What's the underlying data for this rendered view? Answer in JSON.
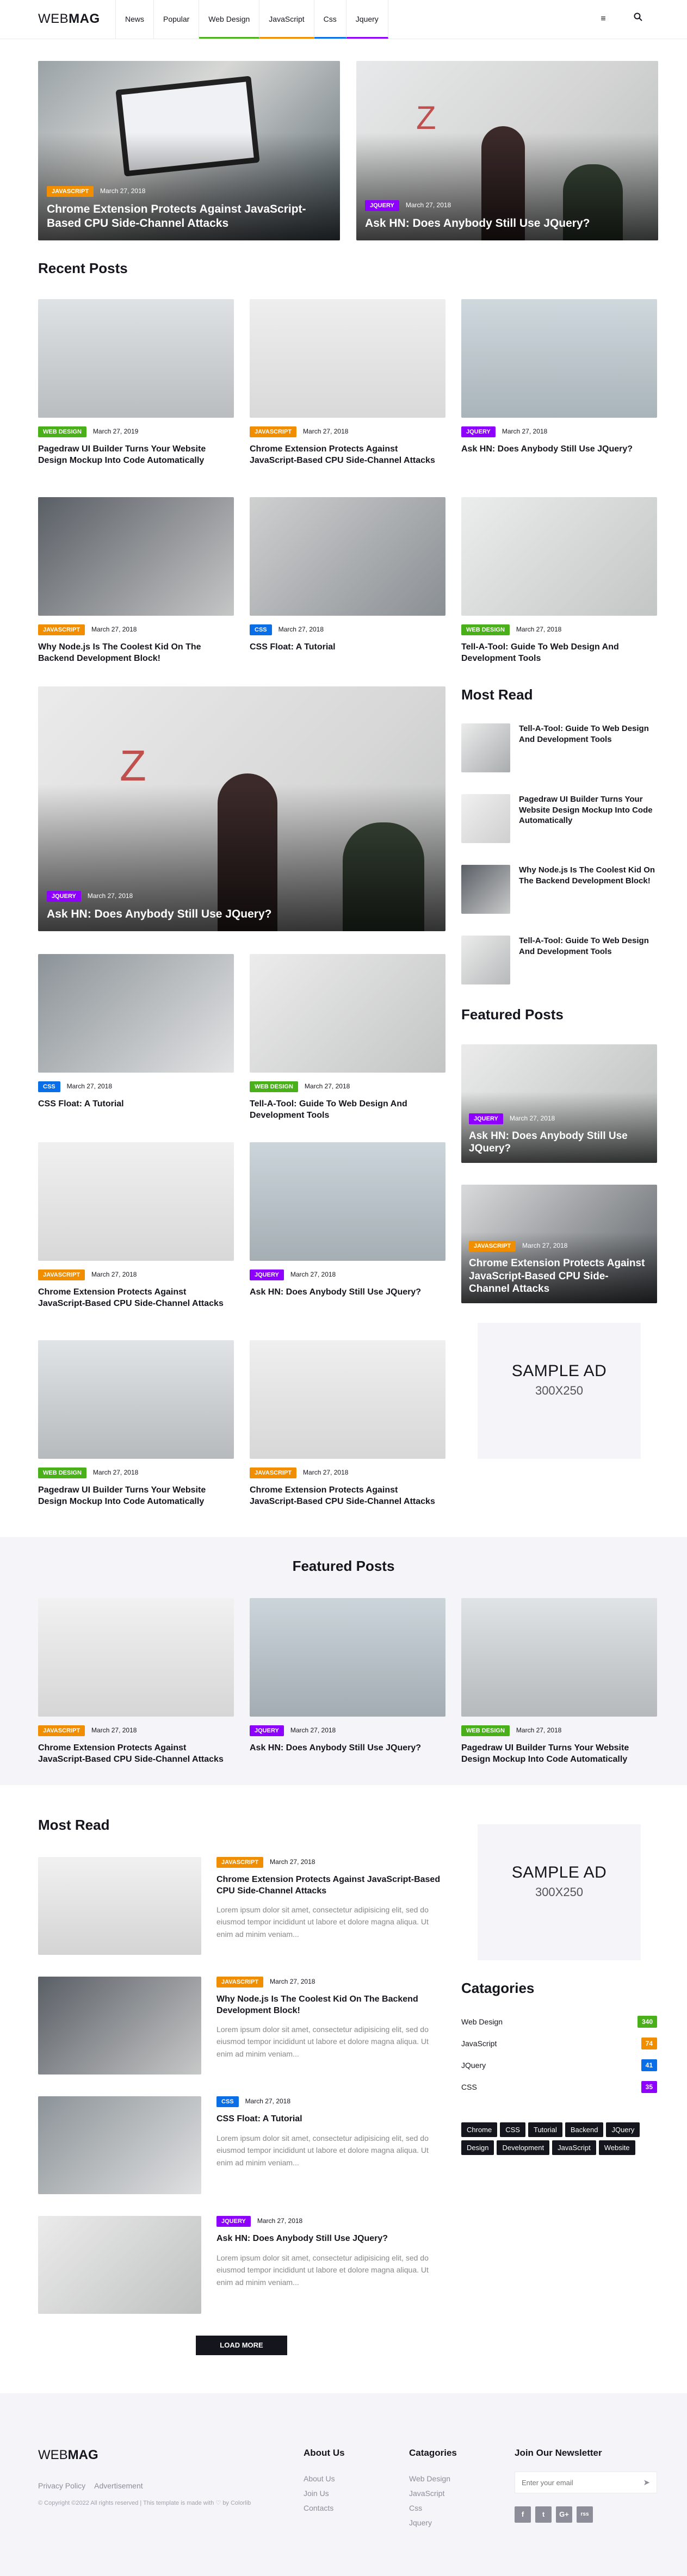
{
  "header": {
    "logo_a": "WEB",
    "logo_b": "MAG",
    "nav": [
      "News",
      "Popular",
      "Web Design",
      "JavaScript",
      "Css",
      "Jquery"
    ],
    "menu_icon": "hamburger-icon",
    "search_icon": "search-icon"
  },
  "colors": {
    "jquery": "#8d00ff",
    "javascript": "#f18e00",
    "css": "#0a6ee6",
    "web_design": "#4ab01a",
    "dark": "#15161d",
    "footer_bg": "#f4f4f9"
  },
  "hero": {
    "left": {
      "badge": "JAVASCRIPT",
      "date": "March 27, 2018",
      "title": "Chrome Extension Protects Against JavaScript-Based CPU Side-Channel Attacks"
    },
    "right": {
      "badge": "JQUERY",
      "date": "March 27, 2018",
      "title": "Ask HN: Does Anybody Still Use JQuery?"
    }
  },
  "recent": {
    "heading": "Recent Posts",
    "posts": [
      {
        "badge": "WEB DESIGN",
        "date": "March 27, 2019",
        "title": "Pagedraw UI Builder Turns Your Website Design Mockup Into Code Automatically"
      },
      {
        "badge": "JAVASCRIPT",
        "date": "March 27, 2018",
        "title": "Chrome Extension Protects Against JavaScript-Based CPU Side-Channel Attacks"
      },
      {
        "badge": "JQUERY",
        "date": "March 27, 2018",
        "title": "Ask HN: Does Anybody Still Use JQuery?"
      },
      {
        "badge": "JAVASCRIPT",
        "date": "March 27, 2018",
        "title": "Why Node.js Is The Coolest Kid On The Backend Development Block!"
      },
      {
        "badge": "CSS",
        "date": "March 27, 2018",
        "title": "CSS Float: A Tutorial"
      },
      {
        "badge": "WEB DESIGN",
        "date": "March 27, 2018",
        "title": "Tell-A-Tool: Guide To Web Design And Development Tools"
      }
    ],
    "big": {
      "badge": "JQUERY",
      "date": "March 27, 2018",
      "title": "Ask HN: Does Anybody Still Use JQuery?"
    },
    "posts2": [
      {
        "badge": "CSS",
        "date": "March 27, 2018",
        "title": "CSS Float: A Tutorial"
      },
      {
        "badge": "WEB DESIGN",
        "date": "March 27, 2018",
        "title": "Tell-A-Tool: Guide To Web Design And Development Tools"
      },
      {
        "badge": "JAVASCRIPT",
        "date": "March 27, 2018",
        "title": "Chrome Extension Protects Against JavaScript-Based CPU Side-Channel Attacks"
      },
      {
        "badge": "JQUERY",
        "date": "March 27, 2018",
        "title": "Ask HN: Does Anybody Still Use JQuery?"
      },
      {
        "badge": "WEB DESIGN",
        "date": "March 27, 2018",
        "title": "Pagedraw UI Builder Turns Your Website Design Mockup Into Code Automatically"
      },
      {
        "badge": "JAVASCRIPT",
        "date": "March 27, 2018",
        "title": "Chrome Extension Protects Against JavaScript-Based CPU Side-Channel Attacks"
      }
    ]
  },
  "sidebar_most_read": {
    "heading": "Most Read",
    "items": [
      "Tell-A-Tool: Guide To Web Design And Development Tools",
      "Pagedraw UI Builder Turns Your Website Design Mockup Into Code Automatically",
      "Why Node.js Is The Coolest Kid On The Backend Development Block!",
      "Tell-A-Tool: Guide To Web Design And Development Tools"
    ]
  },
  "sidebar_featured": {
    "heading": "Featured Posts",
    "items": [
      {
        "badge": "JQUERY",
        "date": "March 27, 2018",
        "title": "Ask HN: Does Anybody Still Use JQuery?"
      },
      {
        "badge": "JAVASCRIPT",
        "date": "March 27, 2018",
        "title": "Chrome Extension Protects Against JavaScript-Based CPU Side-Channel Attacks"
      }
    ]
  },
  "ad": {
    "line1": "SAMPLE AD",
    "line2": "300X250"
  },
  "featured": {
    "heading": "Featured Posts",
    "posts": [
      {
        "badge": "JAVASCRIPT",
        "date": "March 27, 2018",
        "title": "Chrome Extension Protects Against JavaScript-Based CPU Side-Channel Attacks"
      },
      {
        "badge": "JQUERY",
        "date": "March 27, 2018",
        "title": "Ask HN: Does Anybody Still Use JQuery?"
      },
      {
        "badge": "WEB DESIGN",
        "date": "March 27, 2018",
        "title": "Pagedraw UI Builder Turns Your Website Design Mockup Into Code Automatically"
      }
    ]
  },
  "most_read": {
    "heading": "Most Read",
    "excerpt": "Lorem ipsum dolor sit amet, consectetur adipisicing elit, sed do eiusmod tempor incididunt ut labore et dolore magna aliqua. Ut enim ad minim veniam...",
    "posts": [
      {
        "badge": "JAVASCRIPT",
        "date": "March 27, 2018",
        "title": "Chrome Extension Protects Against JavaScript-Based CPU Side-Channel Attacks"
      },
      {
        "badge": "JAVASCRIPT",
        "date": "March 27, 2018",
        "title": "Why Node.js Is The Coolest Kid On The Backend Development Block!"
      },
      {
        "badge": "CSS",
        "date": "March 27, 2018",
        "title": "CSS Float: A Tutorial"
      },
      {
        "badge": "JQUERY",
        "date": "March 27, 2018",
        "title": "Ask HN: Does Anybody Still Use JQuery?"
      }
    ],
    "load_more": "LOAD MORE"
  },
  "categories": {
    "heading": "Catagories",
    "items": [
      {
        "name": "Web Design",
        "count": "340"
      },
      {
        "name": "JavaScript",
        "count": "74"
      },
      {
        "name": "JQuery",
        "count": "41"
      },
      {
        "name": "CSS",
        "count": "35"
      }
    ],
    "tags": [
      "Chrome",
      "CSS",
      "Tutorial",
      "Backend",
      "JQuery",
      "Design",
      "Development",
      "JavaScript",
      "Website"
    ]
  },
  "footer": {
    "logo_a": "WEB",
    "logo_b": "MAG",
    "links": [
      "Privacy Policy",
      "Advertisement"
    ],
    "copyright": "© Copyright ©2022 All rights reserved | This template is made with ♡ by Colorlib",
    "about_heading": "About Us",
    "about_links": [
      "About Us",
      "Join Us",
      "Contacts"
    ],
    "cat_heading": "Catagories",
    "cat_links": [
      "Web Design",
      "JavaScript",
      "Css",
      "Jquery"
    ],
    "newsletter_heading": "Join Our Newsletter",
    "newsletter_placeholder": "Enter your email",
    "send_icon": "paper-plane-icon",
    "social": [
      "f",
      "t",
      "G+",
      "rss"
    ]
  }
}
